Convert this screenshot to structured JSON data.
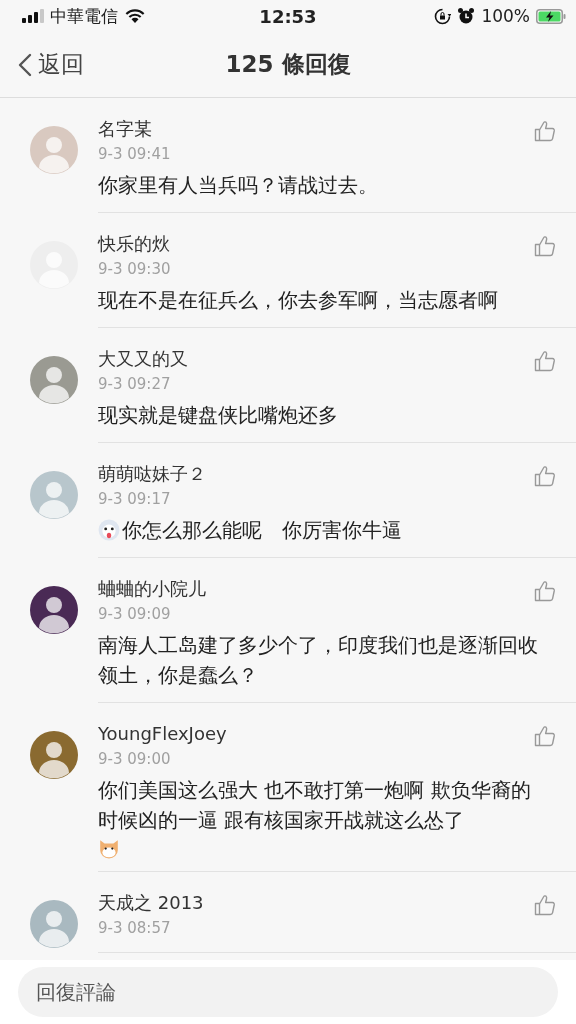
{
  "status_bar": {
    "carrier": "中華電信",
    "time": "12:53",
    "battery": "100%"
  },
  "nav": {
    "back": "返回",
    "title": "125 條回復"
  },
  "comments": [
    {
      "name": "名字某",
      "time": "9-3 09:41",
      "body": "你家里有人当兵吗？请战过去。"
    },
    {
      "name": "快乐的炏",
      "time": "9-3 09:30",
      "body": "现在不是在征兵么，你去参军啊，当志愿者啊"
    },
    {
      "name": "大又又的又",
      "time": "9-3 09:27",
      "body": "现实就是键盘侠比嘴炮还多"
    },
    {
      "name": "萌萌哒妹子２",
      "time": "9-3 09:17",
      "body": "你怎么那么能呢　你厉害你牛逼",
      "lead_emoji": true
    },
    {
      "name": "蛐蛐的小院儿",
      "time": "9-3 09:09",
      "body": "南海人工岛建了多少个了，印度我们也是逐渐回收领土，你是蠢么？"
    },
    {
      "name": "YoungFlexJoey",
      "time": "9-3 09:00",
      "body": "你们美国这么强大 也不敢打第一炮啊 欺负华裔的时候凶的一逼 跟有核国家开战就这么怂了",
      "trail_emoji": true
    },
    {
      "name": "天成之 2013",
      "time": "9-3 08:57"
    }
  ],
  "reply": {
    "placeholder": "回復評論"
  }
}
